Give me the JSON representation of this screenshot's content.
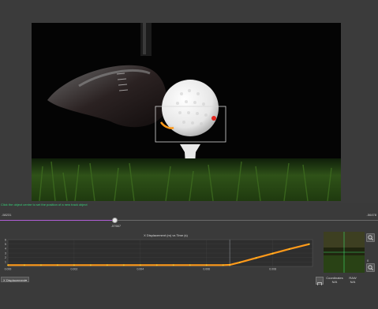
{
  "video": {
    "scene": "golf club striking golf ball on tee over grass, tracked object box with orange trajectory"
  },
  "hint": "Click the object centre to set the position of a new track object",
  "timeline": {
    "start_label": "-58231",
    "end_label": "-56478",
    "current_label": "-57667",
    "progress_fraction": 0.302
  },
  "plot": {
    "title": "X Displacement (m) vs Time (s)",
    "colors": {
      "line": "#ff9a1a",
      "marker": "#ffcf2a"
    }
  },
  "chart_data": {
    "type": "line",
    "title": "X Displacement (m) vs Time (s)",
    "xlabel": "",
    "ylabel": "",
    "xlim": [
      0,
      0.0092
    ],
    "ylim": [
      0,
      6
    ],
    "x_ticks": [
      "0.000",
      "0.002",
      "0.004",
      "0.006",
      "0.008"
    ],
    "y_ticks": [
      "6",
      "5",
      "4",
      "3",
      "2",
      "1"
    ],
    "x_tick_values": [
      0,
      0.002,
      0.004,
      0.006,
      0.008
    ],
    "y_tick_values": [
      6,
      5,
      4,
      3,
      2,
      1
    ],
    "current_time": 0.0067,
    "series": [
      {
        "x": [
          0,
          0.0005,
          0.001,
          0.0015,
          0.002,
          0.0025,
          0.003,
          0.0035,
          0.004,
          0.0045,
          0.005,
          0.0055,
          0.006,
          0.0065,
          0.0067,
          0.007,
          0.0075,
          0.008,
          0.0085,
          0.0091
        ],
        "y": [
          0.3,
          0.3,
          0.3,
          0.3,
          0.3,
          0.3,
          0.3,
          0.3,
          0.3,
          0.3,
          0.3,
          0.3,
          0.3,
          0.3,
          0.35,
          0.9,
          1.9,
          2.9,
          3.9,
          5.0
        ]
      }
    ]
  },
  "thumbnail": {
    "scene": "magnified view of tracked point"
  },
  "zoom": {
    "in_icon": "zoom-in-icon",
    "out_icon": "zoom-out-icon",
    "level": "0"
  },
  "bottom": {
    "dropdown_value": "X Displacement",
    "coordinates_label": "Coordinates",
    "coordinates_value": "N/A",
    "raw_label": "RAW",
    "raw_value": "N/A"
  }
}
